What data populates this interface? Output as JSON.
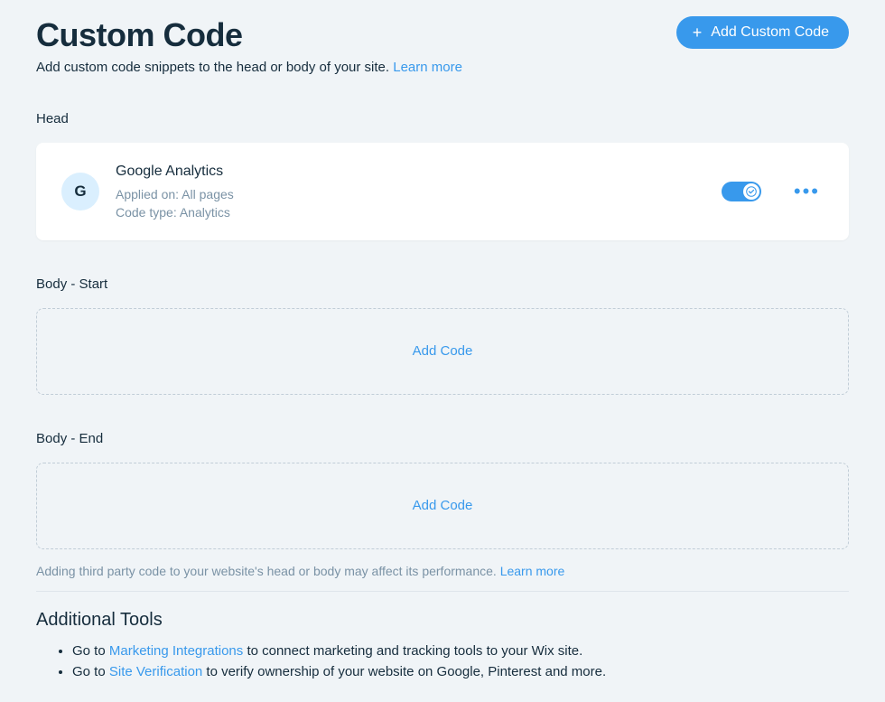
{
  "header": {
    "title": "Custom Code",
    "add_button_label": "Add Custom Code",
    "subtitle_text": "Add custom code snippets to the head or body of your site. ",
    "subtitle_link": "Learn more"
  },
  "sections": {
    "head": {
      "label": "Head",
      "items": [
        {
          "icon_letter": "G",
          "title": "Google Analytics",
          "applied_on_label": "Applied on: ",
          "applied_on_value": "All pages",
          "code_type_label": "Code type: ",
          "code_type_value": "Analytics",
          "enabled": true
        }
      ]
    },
    "body_start": {
      "label": "Body - Start",
      "add_label": "Add Code"
    },
    "body_end": {
      "label": "Body - End",
      "add_label": "Add Code"
    }
  },
  "footnote": {
    "text": "Adding third party code to your website's head or body may affect its performance. ",
    "link": "Learn more"
  },
  "tools": {
    "heading": "Additional Tools",
    "items": [
      {
        "prefix": "Go to ",
        "link": "Marketing Integrations",
        "suffix": " to connect marketing and tracking tools to your Wix site."
      },
      {
        "prefix": "Go to ",
        "link": "Site Verification",
        "suffix": " to verify ownership of your website on Google, Pinterest and more."
      }
    ]
  },
  "colors": {
    "accent": "#3899ec",
    "background": "#f0f4f7"
  }
}
